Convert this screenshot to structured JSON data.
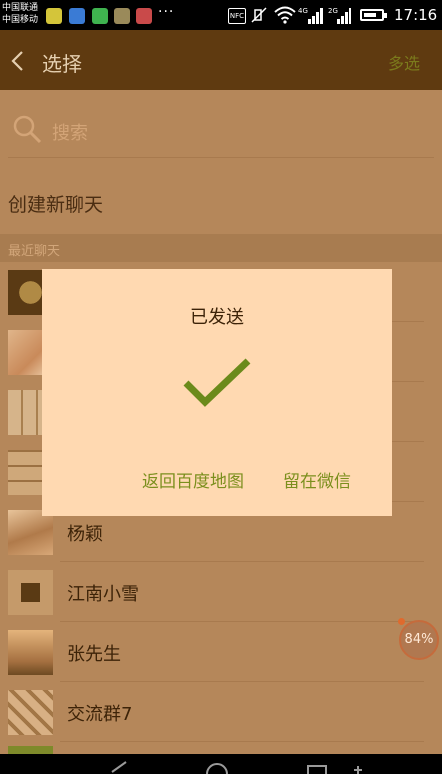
{
  "status_bar": {
    "carrier_1": "中国联通",
    "carrier_2": "中国移动",
    "overflow": "···",
    "nfc": "NFC",
    "net_1": "4G",
    "net_2": "2G",
    "time": "17:16"
  },
  "header": {
    "title": "选择",
    "multi_select": "多选"
  },
  "search": {
    "placeholder": "搜索"
  },
  "create_chat": "创建新聊天",
  "recent": {
    "label": "最近聊天",
    "items": [
      {
        "name": ""
      },
      {
        "name": ""
      },
      {
        "name": ""
      },
      {
        "name": ""
      },
      {
        "name": "杨颖"
      },
      {
        "name": "江南小雪"
      },
      {
        "name": "张先生"
      },
      {
        "name": "交流群7"
      }
    ]
  },
  "badge": {
    "text": "84%"
  },
  "dialog": {
    "title": "已发送",
    "back_button": "返回百度地图",
    "stay_button": "留在微信"
  },
  "colors": {
    "header_bg": "#5f3a10",
    "dialog_bg": "#ffd9b1",
    "accent_green": "#7b8f1d",
    "check_green": "#6b8a1b"
  }
}
